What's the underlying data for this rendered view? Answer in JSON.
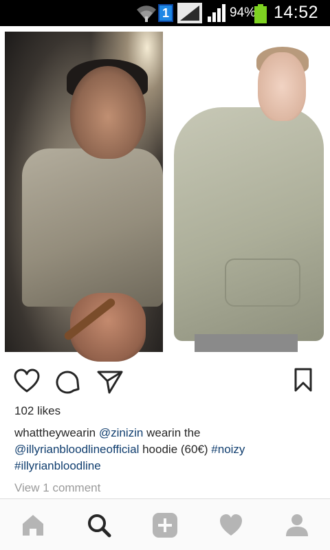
{
  "status_bar": {
    "notification_badge": "1",
    "battery_percent": "94%",
    "time": "14:52"
  },
  "post": {
    "likes_text": "102 likes",
    "caption": {
      "username": "whattheywearin",
      "mention_1": "@zinizin",
      "text_1": " wearin the ",
      "mention_2": "@illyrianbloodlineofficial",
      "text_2": " hoodie (60€) ",
      "hashtag_1": "#noizy",
      "hashtag_2": "#illyrianbloodline"
    },
    "view_comments": "View 1 comment"
  },
  "icons": {
    "like": "heart-outline-icon",
    "comment": "comment-bubble-icon",
    "share": "send-arrow-icon",
    "save": "bookmark-icon",
    "nav_home": "home-icon",
    "nav_search": "search-icon",
    "nav_add": "plus-icon",
    "nav_activity": "heart-icon",
    "nav_profile": "person-icon"
  },
  "colors": {
    "link": "#0f3d6e",
    "muted_text": "#9a9a9a",
    "nav_inactive": "#b5b5b5",
    "nav_active": "#262626",
    "battery_fill": "#7ed321"
  }
}
